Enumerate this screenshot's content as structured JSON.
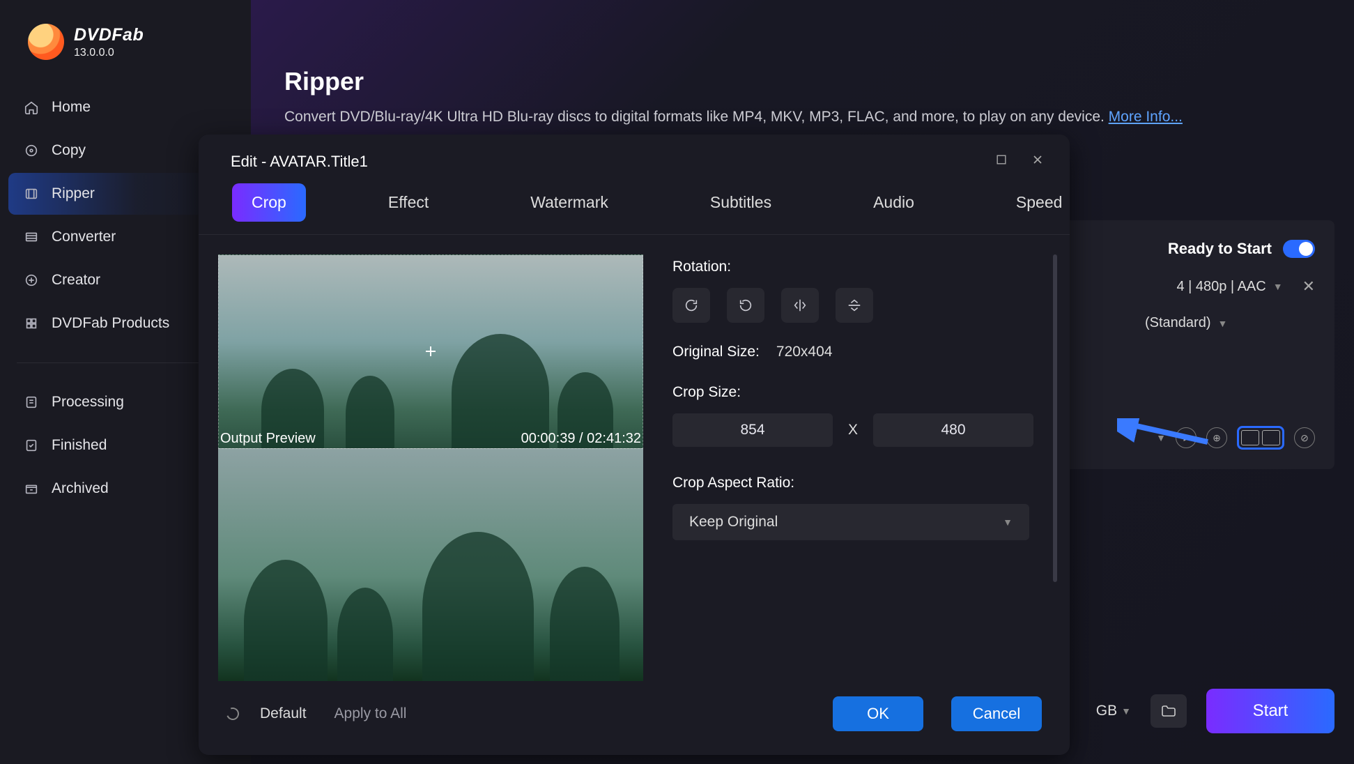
{
  "brand": {
    "name": "DVDFab",
    "version": "13.0.0.0"
  },
  "sidebar": {
    "items": [
      {
        "label": "Home"
      },
      {
        "label": "Copy"
      },
      {
        "label": "Ripper"
      },
      {
        "label": "Converter"
      },
      {
        "label": "Creator"
      },
      {
        "label": "DVDFab Products"
      },
      {
        "label": "Processing"
      },
      {
        "label": "Finished"
      },
      {
        "label": "Archived"
      }
    ],
    "active_index": 2
  },
  "main": {
    "title": "Ripper",
    "description": "Convert DVD/Blu-ray/4K Ultra HD Blu-ray discs to digital formats like MP4, MKV, MP3, FLAC, and more, to play on any device. ",
    "more_info": "More Info..."
  },
  "panel": {
    "ready_label": "Ready to Start",
    "ready_on": true,
    "format_line": "4 | 480p | AAC",
    "quality_line": "(Standard)",
    "size_label": "GB"
  },
  "start_button": "Start",
  "modal": {
    "title": "Edit - AVATAR.Title1",
    "tabs": [
      "Crop",
      "Effect",
      "Watermark",
      "Subtitles",
      "Audio",
      "Speed"
    ],
    "active_tab": 0,
    "preview_label": "Output Preview",
    "time_current": "00:00:39",
    "time_total": "02:41:32",
    "rotation_label": "Rotation:",
    "original_size_label": "Original Size:",
    "original_size_value": "720x404",
    "crop_size_label": "Crop Size:",
    "crop_width": "854",
    "crop_height": "480",
    "crop_size_sep": "X",
    "aspect_label": "Crop Aspect Ratio:",
    "aspect_value": "Keep Original",
    "default_label": "Default",
    "apply_all_label": "Apply to All",
    "ok_label": "OK",
    "cancel_label": "Cancel"
  }
}
